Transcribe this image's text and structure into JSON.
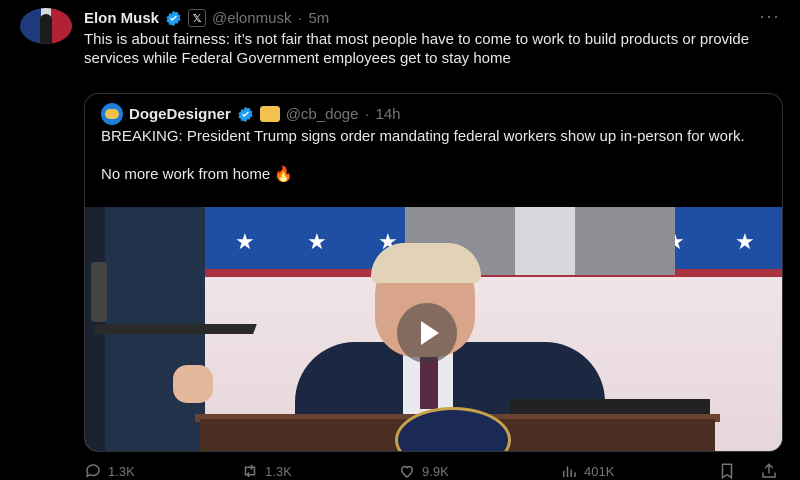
{
  "tweet": {
    "author_name": "Elon Musk",
    "handle": "@elonmusk",
    "separator": "·",
    "time": "5m",
    "more_icon": "more-dots-icon",
    "text": "This is about fairness: it’s not fair that most people have to come to work to build products or provide services while Federal Government employees get to stay home"
  },
  "quote": {
    "author_name": "DogeDesigner",
    "handle": "@cb_doge",
    "separator": "·",
    "time": "14h",
    "line1": "BREAKING: President Trump signs order mandating federal workers show up in-person for work.",
    "line2": "No more work from home 🔥"
  },
  "actions": {
    "replies": "1.3K",
    "retweets": "1.3K",
    "likes": "9.9K",
    "views": "401K"
  },
  "colors": {
    "background": "#000000",
    "text": "#e7e9ea",
    "muted": "#71767b",
    "verified": "#1d9bf0",
    "border": "#2f3336"
  }
}
